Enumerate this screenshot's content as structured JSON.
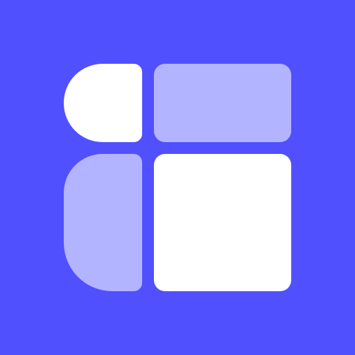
{
  "app_icon": {
    "background_color": "#5050FF",
    "tiles": [
      {
        "name": "top-left",
        "color": "#FFFFFF"
      },
      {
        "name": "top-right",
        "color": "#B3B4FF"
      },
      {
        "name": "bottom-left",
        "color": "#B3B4FF"
      },
      {
        "name": "bottom-right",
        "color": "#FFFFFF"
      }
    ]
  }
}
